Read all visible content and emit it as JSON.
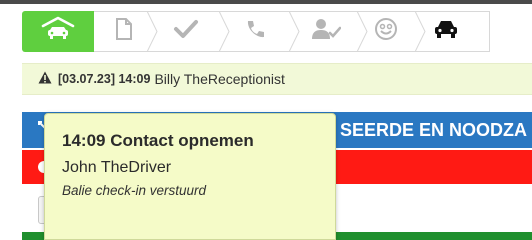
{
  "steps": [
    {
      "icon": "car-garage-icon",
      "active": true
    },
    {
      "icon": "document-icon",
      "active": false
    },
    {
      "icon": "checkmark-icon",
      "active": false
    },
    {
      "icon": "phone-icon",
      "active": false
    },
    {
      "icon": "user-check-icon",
      "active": false
    },
    {
      "icon": "smiley-icon",
      "active": false
    },
    {
      "icon": "car-icon",
      "active": false
    }
  ],
  "notice": {
    "timestamp": "[03.07.23] 14:09",
    "author": "Billy TheReceptionist"
  },
  "banner": {
    "title": "SEERDE EN NOODZA"
  },
  "tooltip": {
    "title": "14:09 Contact opnemen",
    "name": "John TheDriver",
    "note": "Balie check-in verstuurd"
  },
  "colors": {
    "active_step": "#5fcf3f",
    "notice_bg": "#f2f9d8",
    "banner_blue": "#2a78c2",
    "alert_red": "#ff1a14",
    "footer_green": "#1f8f2e",
    "tooltip_bg": "#f5fbc8"
  }
}
